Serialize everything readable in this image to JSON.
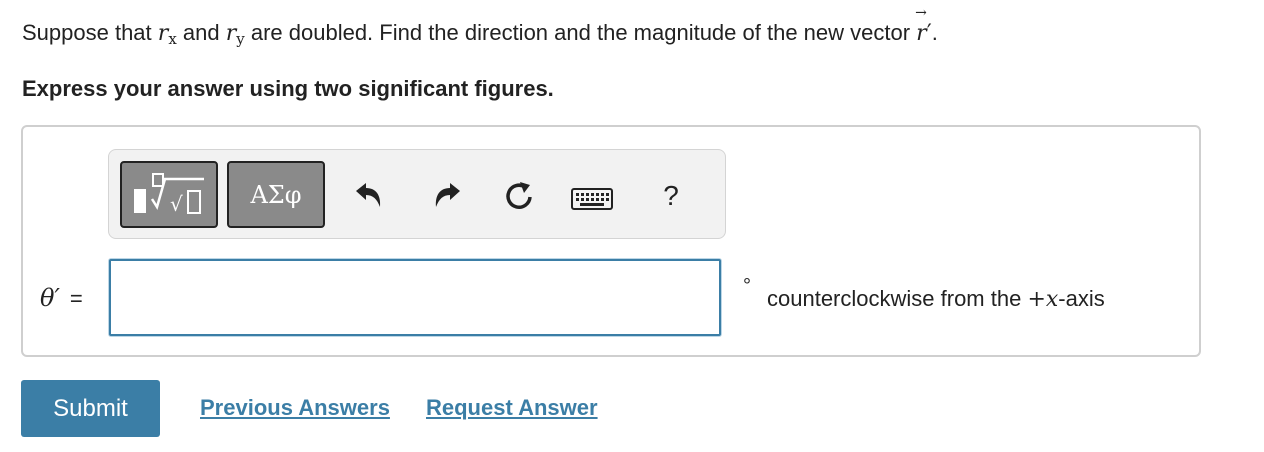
{
  "question": {
    "before": "Suppose that ",
    "rx_var": "r",
    "rx_sub": "x",
    "and": " and ",
    "ry_var": "r",
    "ry_sub": "y",
    "after": " are doubled. Find the direction and the magnitude of the new vector ",
    "vector": "r",
    "vector_prime": "′",
    "vector_arrow": "→",
    "end": "."
  },
  "instruction": "Express your answer using two significant figures.",
  "toolbar": {
    "symbols_label": "ΑΣφ",
    "help_label": "?",
    "icons": [
      "templates-icon",
      "greek-symbols-icon",
      "undo-icon",
      "redo-icon",
      "reset-icon",
      "keyboard-icon",
      "help-icon"
    ]
  },
  "answer": {
    "lhs_var": "θ′",
    "equals": "=",
    "value": "",
    "degree_symbol": "°",
    "unit_text": "counterclockwise from the ",
    "unit_math": "+x",
    "unit_end": "-axis"
  },
  "actions": {
    "submit_label": "Submit",
    "previous_label": "Previous Answers",
    "request_label": "Request Answer"
  },
  "colors": {
    "accent": "#3b7ea6",
    "toolbar_button": "#8a8a8a",
    "border": "#cfcfcf"
  }
}
